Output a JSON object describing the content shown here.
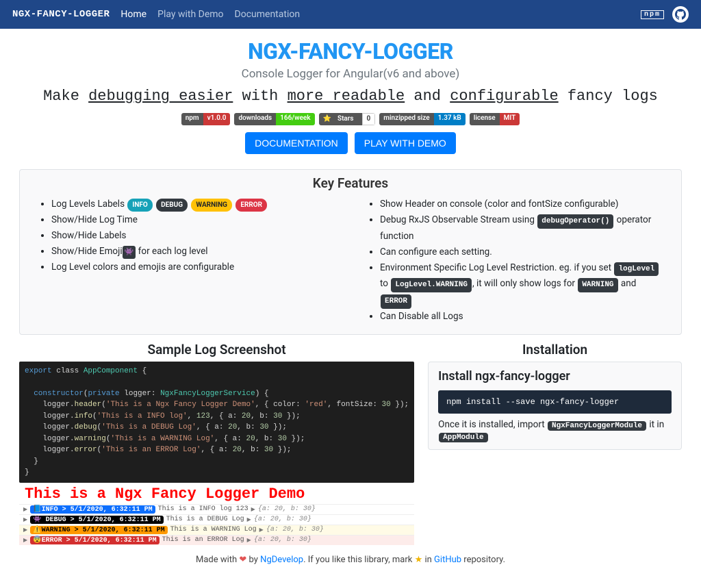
{
  "nav": {
    "brand": "NGX-FANCY-LOGGER",
    "links": [
      "Home",
      "Play with Demo",
      "Documentation"
    ],
    "npm_label": "npm"
  },
  "hero": {
    "title": "NGX-FANCY-LOGGER",
    "subtitle": "Console Logger for Angular(v6 and above)",
    "tag_pre": "Make ",
    "tag_u1": "debugging easier",
    "tag_mid1": " with ",
    "tag_u2": "more readable",
    "tag_mid2": " and ",
    "tag_u3": "configurable",
    "tag_post": " fancy logs"
  },
  "shields": {
    "npm_l": "npm",
    "npm_v": "v1.0.0",
    "dl_l": "downloads",
    "dl_v": "166/week",
    "stars_l": "Stars",
    "stars_v": "0",
    "size_l": "minzipped size",
    "size_v": "1.37 kB",
    "lic_l": "license",
    "lic_v": "MIT"
  },
  "cta": {
    "doc": "DOCUMENTATION",
    "demo": "PLAY WITH DEMO"
  },
  "features": {
    "heading": "Key Features",
    "left": {
      "i0_pre": "Log Levels Labels ",
      "i0_info": "INFO",
      "i0_debug": "DEBUG",
      "i0_warn": "WARNING",
      "i0_err": "ERROR",
      "i1": "Show/Hide Log Time",
      "i2": "Show/Hide Labels",
      "i3_pre": "Show/Hide Emoji",
      "i3_emoji": "👾",
      "i3_post": " for each log level",
      "i4": "Log Level colors and emojis are configurable"
    },
    "right": {
      "i0": "Show Header on console (color and fontSize configurable)",
      "i1_pre": "Debug RxJS Observable Stream using ",
      "i1_code": "debugOperator()",
      "i1_post": " operator function",
      "i2": "Can configure each setting.",
      "i3_pre": "Environment Specific Log Level Restriction. eg. if you set ",
      "i3_c1": "logLevel",
      "i3_mid1": " to ",
      "i3_c2": "LogLevel.WARNING",
      "i3_mid2": ", it will only show logs for ",
      "i3_c3": "WARNING",
      "i3_mid3": " and ",
      "i3_c4": "ERROR",
      "i4": "Can Disable all Logs"
    }
  },
  "sample": {
    "heading": "Sample Log Screenshot",
    "code_lines": {
      "l0_a": "export",
      "l0_b": " class ",
      "l0_c": "AppComponent",
      "l0_d": " {",
      "l1": "",
      "l2_a": "  constructor",
      "l2_b": "(",
      "l2_c": "private",
      "l2_d": " logger: ",
      "l2_e": "NgxFancyLoggerService",
      "l2_f": ") {",
      "l3_a": "    logger.",
      "l3_b": "header",
      "l3_c": "(",
      "l3_d": "'This is a Ngx Fancy Logger Demo'",
      "l3_e": ", { color: ",
      "l3_f": "'red'",
      "l3_g": ", fontSize: ",
      "l3_h": "30",
      "l3_i": " });",
      "l4_a": "    logger.",
      "l4_b": "info",
      "l4_c": "(",
      "l4_d": "'This is a INFO log'",
      "l4_e": ", ",
      "l4_f": "123",
      "l4_g": ", { a: ",
      "l4_h": "20",
      "l4_i": ", b: ",
      "l4_j": "30",
      "l4_k": " });",
      "l5_a": "    logger.",
      "l5_b": "debug",
      "l5_c": "(",
      "l5_d": "'This is a DEBUG Log'",
      "l5_e": ", { a: ",
      "l5_f": "20",
      "l5_g": ", b: ",
      "l5_h": "30",
      "l5_i": " });",
      "l6_a": "    logger.",
      "l6_b": "warning",
      "l6_c": "(",
      "l6_d": "'This is a WARNING Log'",
      "l6_e": ", { a: ",
      "l6_f": "20",
      "l6_g": ", b: ",
      "l6_h": "30",
      "l6_i": " });",
      "l7_a": "    logger.",
      "l7_b": "error",
      "l7_c": "(",
      "l7_d": "'This is an ERROR Log'",
      "l7_e": ", { a: ",
      "l7_f": "20",
      "l7_g": ", b: ",
      "l7_h": "30",
      "l7_i": " });",
      "l8": "  }",
      "l9": "}"
    },
    "demo_header": "This is a Ngx Fancy Logger Demo",
    "logs": [
      {
        "tag": "📘INFO > 5/1/2020, 6:32:11 PM",
        "msg": "This is a INFO log 123",
        "obj": "{a: 20, b: 30}",
        "tag_bg": "#0d6efd",
        "tag_fg": "#fff",
        "row_bg": "#fff"
      },
      {
        "tag": "👾 DEBUG > 5/1/2020, 6:32:11 PM",
        "msg": "This is a DEBUG Log",
        "obj": "{a: 20, b: 30}",
        "tag_bg": "#000",
        "tag_fg": "#fff",
        "row_bg": "#fff"
      },
      {
        "tag": "⚠️WARNING > 5/1/2020, 6:32:11 PM",
        "msg": "This is a WARNING Log",
        "obj": "{a: 20, b: 30}",
        "tag_bg": "#ff9800",
        "tag_fg": "#000",
        "row_bg": "#fffbe6"
      },
      {
        "tag": "😨ERROR > 5/1/2020, 6:32:11 PM",
        "msg": "This is an ERROR Log",
        "obj": "{a: 20, b: 30}",
        "tag_bg": "#d32f2f",
        "tag_fg": "#fff",
        "row_bg": "#fdecea"
      }
    ]
  },
  "install": {
    "heading": "Installation",
    "card_title": "Install ngx-fancy-logger",
    "cmd": "npm install --save ngx-fancy-logger",
    "note_pre": "Once it is installed, import ",
    "note_c1": "NgxFancyLoggerModule",
    "note_mid": " it in ",
    "note_c2": "AppModule"
  },
  "footer": {
    "pre": "Made with ",
    "by": " by ",
    "author": "NgDevelop",
    "mid": ". If you like this library, mark ",
    "in": " in ",
    "gh": "GitHub",
    "post": " repository."
  }
}
